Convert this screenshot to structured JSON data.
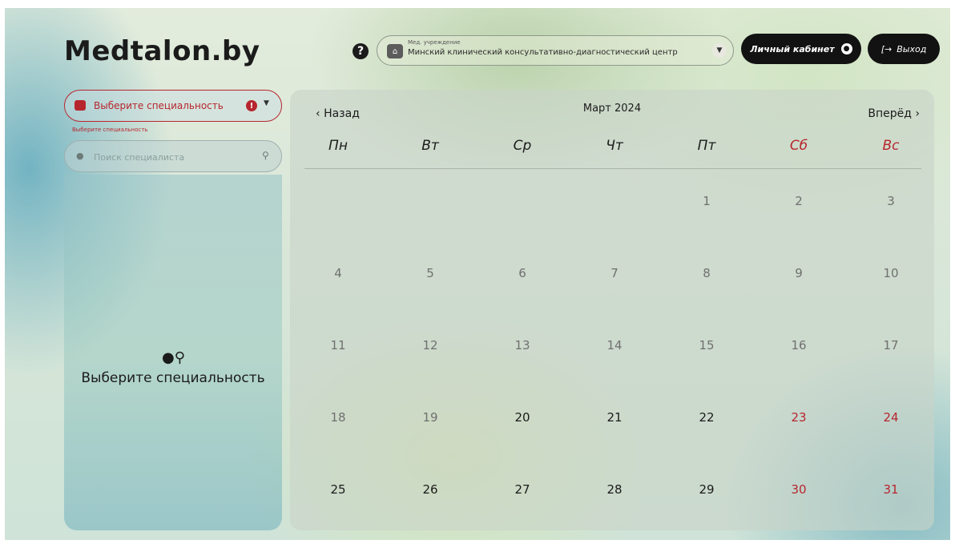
{
  "header": {
    "logo": "Medtalon.by",
    "help_icon": "question-circle-icon",
    "institution_label": "Мед. учреждение",
    "institution_value": "Минский клинический консультативно-диагностический центр",
    "cabinet_label": "Личный кабинет",
    "exit_label": "Выход"
  },
  "sidebar": {
    "specialty_placeholder": "Выберите специальность",
    "specialty_hint": "Выберите специальность",
    "search_placeholder": "Поиск специалиста",
    "empty_text": "Выберите специальность"
  },
  "calendar": {
    "back_label": "Назад",
    "month": "Март 2024",
    "forward_label": "Вперёд",
    "weekdays": [
      "Пн",
      "Вт",
      "Ср",
      "Чт",
      "Пт",
      "Сб",
      "Вс"
    ],
    "weeks": [
      [
        "",
        "",
        "",
        "",
        "1",
        "2",
        "3"
      ],
      [
        "4",
        "5",
        "6",
        "7",
        "8",
        "9",
        "10"
      ],
      [
        "11",
        "12",
        "13",
        "14",
        "15",
        "16",
        "17"
      ],
      [
        "18",
        "19",
        "20",
        "21",
        "22",
        "23",
        "24"
      ],
      [
        "25",
        "26",
        "27",
        "28",
        "29",
        "30",
        "31"
      ]
    ],
    "first_available_day": "20",
    "colors": {
      "weekend": "#b7262e",
      "active": "#1b1b1b",
      "disabled": "#707070"
    }
  }
}
